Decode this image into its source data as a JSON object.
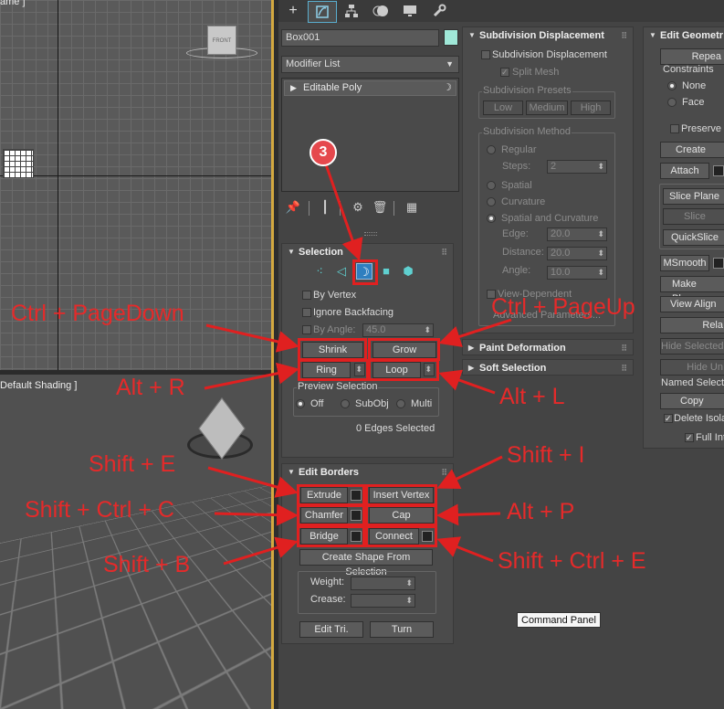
{
  "viewports": {
    "top_label": "ame ]",
    "top_cube_label": "FRONT",
    "persp_label": "Default Shading ]"
  },
  "command_panel": {
    "tabs": [
      "create-icon",
      "modify-icon",
      "hierarchy-icon",
      "motion-icon",
      "display-icon",
      "utilities-icon"
    ],
    "object_name": "Box001",
    "object_color": "#a0e8d8",
    "modifier_list": "Modifier List",
    "stack_item": "Editable Poly",
    "badge": "3"
  },
  "selection": {
    "title": "Selection",
    "by_vertex": "By Vertex",
    "ignore_backfacing": "Ignore Backfacing",
    "by_angle": "By Angle:",
    "by_angle_value": "45.0",
    "shrink": "Shrink",
    "grow": "Grow",
    "ring": "Ring",
    "loop": "Loop",
    "preview_selection": "Preview Selection",
    "preview_off": "Off",
    "preview_subobj": "SubObj",
    "preview_multi": "Multi",
    "status": "0 Edges Selected"
  },
  "edit_borders": {
    "title": "Edit Borders",
    "extrude": "Extrude",
    "insert_vertex": "Insert Vertex",
    "chamfer": "Chamfer",
    "cap": "Cap",
    "bridge": "Bridge",
    "connect": "Connect",
    "create_shape": "Create Shape From Selection",
    "weight": "Weight:",
    "crease": "Crease:",
    "edit_tri": "Edit Tri.",
    "turn": "Turn"
  },
  "subdivision": {
    "title": "Subdivision Displacement",
    "subdiv_disp": "Subdivision Displacement",
    "split_mesh": "Split Mesh",
    "presets": "Subdivision Presets",
    "low": "Low",
    "medium": "Medium",
    "high": "High",
    "method": "Subdivision Method",
    "regular": "Regular",
    "steps": "Steps:",
    "steps_value": "2",
    "spatial": "Spatial",
    "curvature": "Curvature",
    "spatial_curvature": "Spatial and Curvature",
    "edge": "Edge:",
    "edge_value": "20.0",
    "distance": "Distance:",
    "distance_value": "20.0",
    "angle": "Angle:",
    "angle_value": "10.0",
    "view_dependent": "View-Dependent",
    "advanced": "Advanced Parameters..."
  },
  "paint_deformation": "Paint Deformation",
  "soft_selection": "Soft Selection",
  "edit_geometry": {
    "title": "Edit Geometr",
    "repeat": "Repea",
    "constraints": "Constraints",
    "none": "None",
    "face": "Face",
    "preserve": "Preserve",
    "create": "Create",
    "attach": "Attach",
    "slice_plane": "Slice Plane",
    "slice": "Slice",
    "quickslice": "QuickSlice",
    "msmooth": "MSmooth",
    "make_planar": "Make Planar",
    "view_align": "View Align",
    "relax": "Rela",
    "hide_selected": "Hide Selected",
    "hide_unselected": "Hide Un",
    "named_selection": "Named Selectio",
    "copy": "Copy",
    "delete_isolated": "Delete Isola",
    "full_interactivity": "Full Int"
  },
  "tooltip": "Command Panel",
  "shortcuts": {
    "shrink": "Ctrl + PageDown",
    "grow": "Ctrl + PageUp",
    "ring": "Alt + R",
    "loop": "Alt + L",
    "extrude": "Shift + E",
    "insert_vertex": "Shift + I",
    "chamfer": "Shift + Ctrl + C",
    "cap": "Alt + P",
    "bridge": "Shift + B",
    "connect": "Shift + Ctrl + E"
  },
  "colors": {
    "annotation_red": "#e02020",
    "active_blue": "#5aaecf",
    "viewport_border": "#d4a940"
  }
}
